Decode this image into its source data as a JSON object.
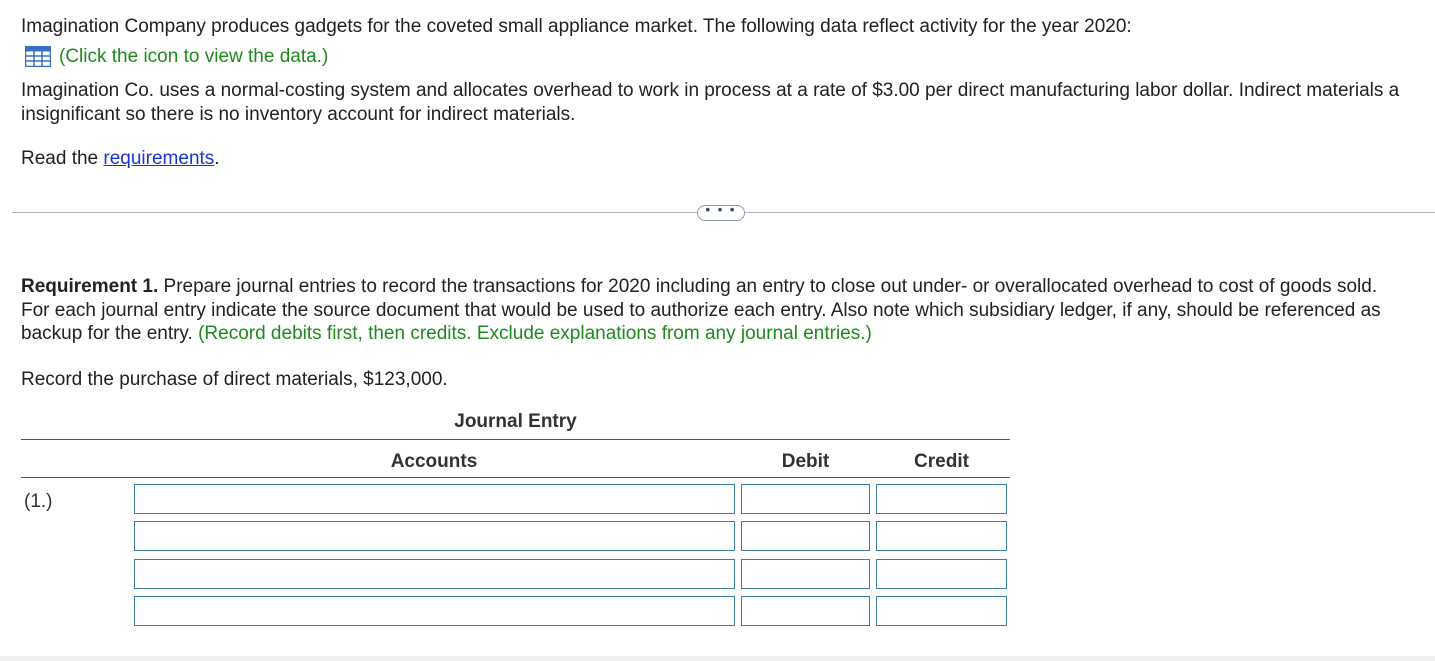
{
  "intro": {
    "line1": "Imagination Company produces gadgets for the coveted small appliance market. The following data reflect activity for the year 2020:",
    "data_link": "(Click the icon to view the data.)",
    "data_icon": "spreadsheet-grid-icon",
    "para_line1": "Imagination Co. uses a normal-costing system and allocates overhead to work in process at a rate of $3.00 per direct manufacturing labor dollar. Indirect materials a",
    "para_line2": "insignificant so there is no inventory account for indirect materials.",
    "read_prefix": "Read the ",
    "requirements_link": "requirements",
    "read_suffix": "."
  },
  "divider": {
    "more_label": "• • •"
  },
  "requirement": {
    "label": "Requirement 1.",
    "line1_rest": " Prepare journal entries to record the transactions for 2020 including an entry to close out under- or overallocated overhead to cost of goods sold.",
    "line2": "For each journal entry indicate the source document that would be used to authorize each entry. Also note which subsidiary ledger, if any, should be referenced as",
    "line3_start": "backup for the entry. ",
    "line3_green": "(Record debits first, then credits. Exclude explanations from any journal entries.)",
    "task": "Record the purchase of direct materials, $123,000."
  },
  "journal": {
    "title": "Journal Entry",
    "headers": {
      "accounts": "Accounts",
      "debit": "Debit",
      "credit": "Credit"
    },
    "entry_label": "(1.)",
    "rows": [
      {
        "account": "",
        "debit": "",
        "credit": ""
      },
      {
        "account": "",
        "debit": "",
        "credit": ""
      },
      {
        "account": "",
        "debit": "",
        "credit": ""
      },
      {
        "account": "",
        "debit": "",
        "credit": ""
      }
    ]
  },
  "colors": {
    "green": "#1e8a1e",
    "link_blue": "#1a35d1",
    "input_border": "#3b7fa6",
    "icon_blue": "#3a6fc4"
  }
}
